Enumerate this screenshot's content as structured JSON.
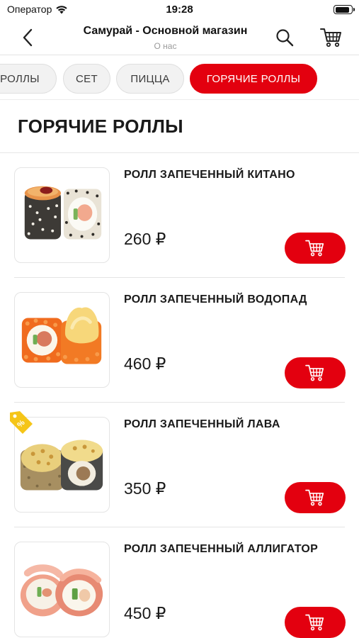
{
  "status_bar": {
    "carrier": "Оператор",
    "time": "19:28",
    "battery_level": 0.9
  },
  "nav": {
    "title": "Самурай - Основной магазин",
    "subtitle": "О нас"
  },
  "icons": {
    "back": "chevron-left-icon",
    "search": "search-icon",
    "cart": "shopping-cart-icon",
    "add_to_cart": "shopping-cart-icon",
    "wifi": "wifi-icon",
    "promo": "price-tag-icon"
  },
  "tabs": [
    {
      "label": "РОЛЛЫ",
      "active": false
    },
    {
      "label": "СЕТ",
      "active": false
    },
    {
      "label": "ПИЦЦА",
      "active": false
    },
    {
      "label": "ГОРЯЧИЕ РОЛЛЫ",
      "active": true
    }
  ],
  "section": {
    "title": "ГОРЯЧИЕ РОЛЛЫ"
  },
  "products": [
    {
      "name": "РОЛЛ ЗАПЕЧЕННЫЙ КИТАНО",
      "price": "260 ₽"
    },
    {
      "name": "РОЛЛ ЗАПЕЧЕННЫЙ ВОДОПАД",
      "price": "460 ₽"
    },
    {
      "name": "РОЛЛ ЗАПЕЧЕННЫЙ ЛАВА",
      "price": "350 ₽",
      "promo_tag": "%"
    },
    {
      "name": "РОЛЛ ЗАПЕЧЕННЫЙ АЛЛИГАТОР",
      "price": "450 ₽"
    }
  ],
  "colors": {
    "accent": "#e3000f",
    "promo": "#f5c518",
    "text": "#1a1a1a",
    "muted": "#9a9a9a"
  }
}
